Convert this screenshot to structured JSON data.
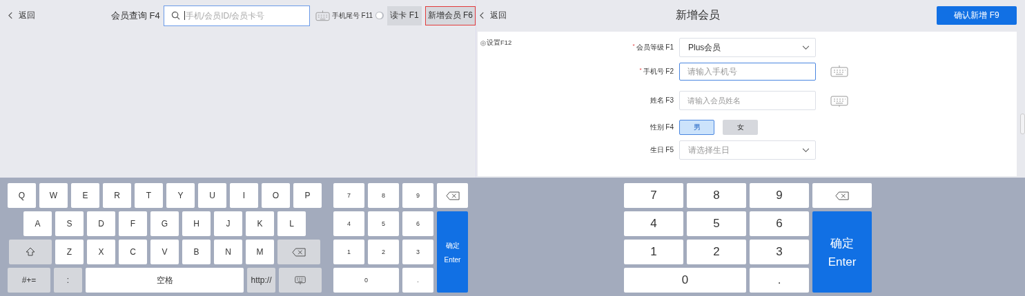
{
  "left": {
    "back": "返回",
    "search": {
      "label": "会员查询 F4",
      "placeholder": "手机/会员ID/会员卡号"
    },
    "phone_tail": {
      "label": "手机尾号 F11",
      "on": false
    },
    "buttons": [
      {
        "label": "读卡 F1",
        "selected": false
      },
      {
        "label": "新增会员 F6",
        "selected": true
      }
    ],
    "keyboard": {
      "top_row": [
        {
          "kind": "letter",
          "label": "Q"
        },
        {
          "kind": "letter",
          "label": "W"
        },
        {
          "kind": "letter",
          "label": "E"
        },
        {
          "kind": "letter",
          "label": "R"
        },
        {
          "kind": "letter",
          "label": "T"
        },
        {
          "kind": "letter",
          "label": "Y"
        },
        {
          "kind": "letter",
          "label": "U"
        },
        {
          "kind": "letter",
          "label": "I"
        },
        {
          "kind": "letter",
          "label": "O"
        },
        {
          "kind": "letter",
          "label": "P"
        }
      ],
      "home_row": [
        {
          "kind": "letter",
          "label": "A"
        },
        {
          "kind": "letter",
          "label": "S"
        },
        {
          "kind": "letter",
          "label": "D"
        },
        {
          "kind": "letter",
          "label": "F"
        },
        {
          "kind": "letter",
          "label": "G"
        },
        {
          "kind": "letter",
          "label": "H"
        },
        {
          "kind": "letter",
          "label": "J"
        },
        {
          "kind": "letter",
          "label": "K"
        },
        {
          "kind": "letter",
          "label": "L"
        }
      ],
      "shift_row": [
        {
          "kind": "shift"
        },
        {
          "kind": "letter",
          "label": "Z"
        },
        {
          "kind": "letter",
          "label": "X"
        },
        {
          "kind": "letter",
          "label": "C"
        },
        {
          "kind": "letter",
          "label": "V"
        },
        {
          "kind": "letter",
          "label": "B"
        },
        {
          "kind": "letter",
          "label": "N"
        },
        {
          "kind": "letter",
          "label": "M"
        },
        {
          "kind": "backspace"
        }
      ],
      "space_row": [
        {
          "kind": "modifier",
          "label": "#+="
        },
        {
          "kind": "function",
          "label": ":"
        },
        {
          "kind": "space",
          "label": "空格"
        },
        {
          "kind": "function",
          "label": "http://"
        },
        {
          "kind": "keyboard"
        }
      ],
      "numpad": [
        {
          "kind": "digit",
          "label": "7"
        },
        {
          "kind": "digit",
          "label": "8"
        },
        {
          "kind": "digit",
          "label": "9"
        },
        {
          "kind": "backspace"
        },
        {
          "kind": "digit",
          "label": "4"
        },
        {
          "kind": "digit",
          "label": "5"
        },
        {
          "kind": "digit",
          "label": "6"
        },
        {
          "kind": "digit",
          "label": "1"
        },
        {
          "kind": "digit",
          "label": "2"
        },
        {
          "kind": "digit",
          "label": "3"
        },
        {
          "kind": "wide",
          "label": "0"
        },
        {
          "kind": "digit",
          "label": "."
        },
        {
          "kind": "enter",
          "label": "确定",
          "sublabel": "Enter"
        }
      ]
    }
  },
  "right": {
    "back": "返回",
    "title": "新增会员",
    "confirm": "确认新增 F9",
    "settings": "设置F12",
    "fields": [
      {
        "kind": "select",
        "required_mark": "*",
        "label": "会员等级 F1",
        "value": "Plus会员"
      },
      {
        "kind": "input",
        "required_mark": "*",
        "label": "手机号 F2",
        "placeholder": "请输入手机号",
        "focused": true
      },
      {
        "kind": "input",
        "label": "姓名 F3",
        "placeholder": "请输入会员姓名",
        "focused": false
      },
      {
        "kind": "choice",
        "label": "性别 F4",
        "options": [
          {
            "label": "男",
            "selected": true
          },
          {
            "label": "女",
            "selected": false
          }
        ]
      },
      {
        "kind": "select",
        "label": "生日 F5",
        "placeholder": "请选择生日"
      }
    ],
    "numpad": [
      {
        "kind": "digit",
        "label": "7"
      },
      {
        "kind": "digit",
        "label": "8"
      },
      {
        "kind": "digit",
        "label": "9"
      },
      {
        "kind": "backspace"
      },
      {
        "kind": "digit",
        "label": "4"
      },
      {
        "kind": "digit",
        "label": "5"
      },
      {
        "kind": "digit",
        "label": "6"
      },
      {
        "kind": "digit",
        "label": "1"
      },
      {
        "kind": "digit",
        "label": "2"
      },
      {
        "kind": "digit",
        "label": "3"
      },
      {
        "kind": "wide",
        "label": "0"
      },
      {
        "kind": "digit",
        "label": "."
      },
      {
        "kind": "enter",
        "label": "确定",
        "sublabel": "Enter"
      }
    ]
  }
}
